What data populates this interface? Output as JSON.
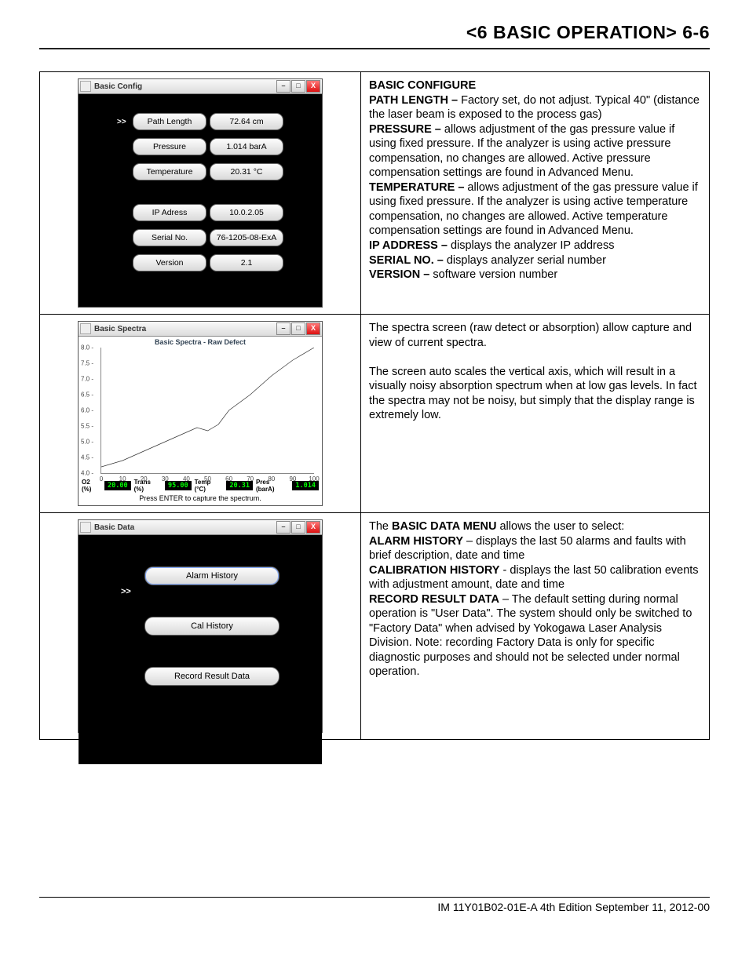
{
  "header": "<6 BASIC OPERATION>  6-6",
  "row1": {
    "window_title": "Basic Config",
    "fields": [
      {
        "label": "Path Length",
        "value": "72.64 cm",
        "selected": true
      },
      {
        "label": "Pressure",
        "value": "1.014 barA"
      },
      {
        "label": "Temperature",
        "value": "20.31 °C"
      },
      {
        "label": "IP Adress",
        "value": "10.0.2.05"
      },
      {
        "label": "Serial No.",
        "value": "76-1205-08-ExA"
      },
      {
        "label": "Version",
        "value": "2.1"
      }
    ],
    "desc": {
      "title": "BASIC CONFIGURE",
      "items": [
        {
          "h": "PATH LENGTH –",
          "t": "Factory set, do not adjust. Typical 40\" (distance the laser beam is exposed to the process gas)"
        },
        {
          "h": "PRESSURE –",
          "t": "allows adjustment of the gas pressure value if using fixed pressure.  If the analyzer is using active pressure compensation, no changes are allowed. Active pressure compensation settings are found in Advanced Menu."
        },
        {
          "h": "TEMPERATURE –",
          "t": "allows adjustment of the gas pressure value if using fixed pressure.  If the analyzer is using active temperature compensation, no changes are allowed.  Active temperature compensation settings are found in Advanced Menu."
        },
        {
          "h": "IP ADDRESS –",
          "t": "displays the analyzer IP address"
        },
        {
          "h": "SERIAL NO. –",
          "t": "displays analyzer serial number"
        },
        {
          "h": "VERSION –",
          "t": "software version number"
        }
      ]
    }
  },
  "row2": {
    "window_title": "Basic Spectra",
    "plot_title": "Basic Spectra - Raw Defect",
    "status": [
      {
        "l": "O2 (%)",
        "v": "20.00"
      },
      {
        "l": "Trans (%)",
        "v": "95.00"
      },
      {
        "l": "Temp (°C)",
        "v": "20.31"
      },
      {
        "l": "Pres (barA)",
        "v": "1.014"
      }
    ],
    "hint": "Press ENTER to capture the spectrum.",
    "desc_p1": "The spectra screen (raw detect or absorption) allow capture and view of current spectra.",
    "desc_p2": "The screen auto scales the vertical axis, which will result in a visually noisy absorption spectrum when at low gas levels.  In fact the spectra may not be noisy, but simply that the display range is extremely low."
  },
  "row3": {
    "window_title": "Basic Data",
    "buttons": [
      "Alarm History",
      "Cal History",
      "Record Result Data"
    ],
    "desc": {
      "lead_pre": "The ",
      "lead_b": "BASIC DATA MENU",
      "lead_post": " allows the user to select:",
      "items": [
        {
          "h": "ALARM HISTORY",
          "t": " – displays the last 50 alarms and faults with brief description, date and time"
        },
        {
          "h": "CALIBRATION HISTORY",
          "t": " - displays the last 50 calibration events with adjustment amount, date and time"
        },
        {
          "h": "RECORD RESULT DATA",
          "t": " – The default setting during normal operation is \"User Data\". The system should only be switched to \"Factory Data\" when advised by Yokogawa Laser Analysis Division. Note: recording Factory Data is only for specific diagnostic purposes and should not be selected under normal operation."
        }
      ]
    }
  },
  "chart_data": {
    "type": "line",
    "title": "Basic Spectra - Raw Defect",
    "xlabel": "",
    "ylabel": "",
    "xlim": [
      0,
      100
    ],
    "ylim": [
      4.0,
      8.0
    ],
    "xticks": [
      0,
      10,
      20,
      30,
      40,
      50,
      60,
      70,
      80,
      90,
      100
    ],
    "yticks": [
      4.0,
      4.5,
      5.0,
      5.5,
      6.0,
      6.5,
      7.0,
      7.5,
      8.0
    ],
    "series": [
      {
        "name": "raw",
        "x": [
          0,
          10,
          20,
          30,
          40,
          45,
          50,
          55,
          60,
          70,
          80,
          90,
          100
        ],
        "y": [
          4.2,
          4.4,
          4.7,
          5.0,
          5.3,
          5.45,
          5.35,
          5.55,
          6.0,
          6.5,
          7.1,
          7.6,
          8.0
        ]
      }
    ]
  },
  "footer": "IM 11Y01B02-01E-A  4th Edition September 11, 2012-00"
}
